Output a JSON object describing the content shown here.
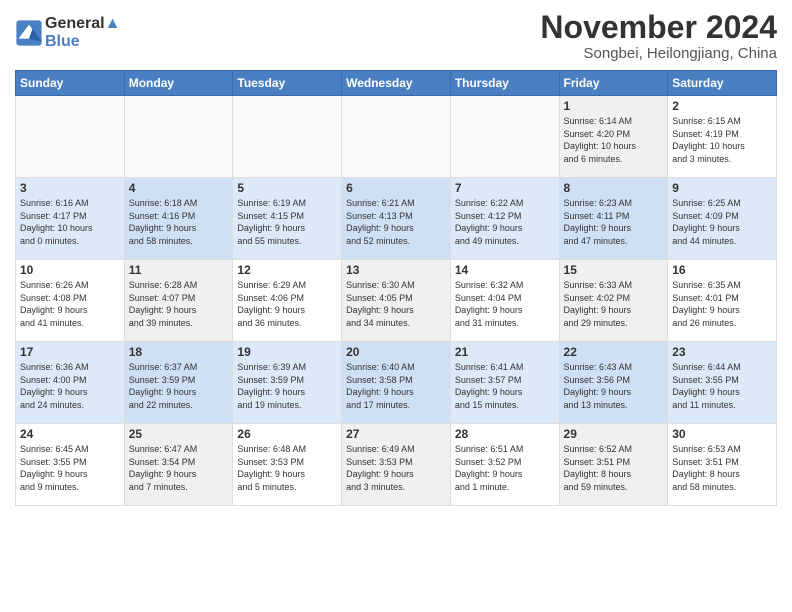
{
  "header": {
    "logo_line1": "General",
    "logo_line2": "Blue",
    "month": "November 2024",
    "location": "Songbei, Heilongjiang, China"
  },
  "days_of_week": [
    "Sunday",
    "Monday",
    "Tuesday",
    "Wednesday",
    "Thursday",
    "Friday",
    "Saturday"
  ],
  "weeks": [
    [
      {
        "day": "",
        "info": ""
      },
      {
        "day": "",
        "info": ""
      },
      {
        "day": "",
        "info": ""
      },
      {
        "day": "",
        "info": ""
      },
      {
        "day": "",
        "info": ""
      },
      {
        "day": "1",
        "info": "Sunrise: 6:14 AM\nSunset: 4:20 PM\nDaylight: 10 hours\nand 6 minutes."
      },
      {
        "day": "2",
        "info": "Sunrise: 6:15 AM\nSunset: 4:19 PM\nDaylight: 10 hours\nand 3 minutes."
      }
    ],
    [
      {
        "day": "3",
        "info": "Sunrise: 6:16 AM\nSunset: 4:17 PM\nDaylight: 10 hours\nand 0 minutes."
      },
      {
        "day": "4",
        "info": "Sunrise: 6:18 AM\nSunset: 4:16 PM\nDaylight: 9 hours\nand 58 minutes."
      },
      {
        "day": "5",
        "info": "Sunrise: 6:19 AM\nSunset: 4:15 PM\nDaylight: 9 hours\nand 55 minutes."
      },
      {
        "day": "6",
        "info": "Sunrise: 6:21 AM\nSunset: 4:13 PM\nDaylight: 9 hours\nand 52 minutes."
      },
      {
        "day": "7",
        "info": "Sunrise: 6:22 AM\nSunset: 4:12 PM\nDaylight: 9 hours\nand 49 minutes."
      },
      {
        "day": "8",
        "info": "Sunrise: 6:23 AM\nSunset: 4:11 PM\nDaylight: 9 hours\nand 47 minutes."
      },
      {
        "day": "9",
        "info": "Sunrise: 6:25 AM\nSunset: 4:09 PM\nDaylight: 9 hours\nand 44 minutes."
      }
    ],
    [
      {
        "day": "10",
        "info": "Sunrise: 6:26 AM\nSunset: 4:08 PM\nDaylight: 9 hours\nand 41 minutes."
      },
      {
        "day": "11",
        "info": "Sunrise: 6:28 AM\nSunset: 4:07 PM\nDaylight: 9 hours\nand 39 minutes."
      },
      {
        "day": "12",
        "info": "Sunrise: 6:29 AM\nSunset: 4:06 PM\nDaylight: 9 hours\nand 36 minutes."
      },
      {
        "day": "13",
        "info": "Sunrise: 6:30 AM\nSunset: 4:05 PM\nDaylight: 9 hours\nand 34 minutes."
      },
      {
        "day": "14",
        "info": "Sunrise: 6:32 AM\nSunset: 4:04 PM\nDaylight: 9 hours\nand 31 minutes."
      },
      {
        "day": "15",
        "info": "Sunrise: 6:33 AM\nSunset: 4:02 PM\nDaylight: 9 hours\nand 29 minutes."
      },
      {
        "day": "16",
        "info": "Sunrise: 6:35 AM\nSunset: 4:01 PM\nDaylight: 9 hours\nand 26 minutes."
      }
    ],
    [
      {
        "day": "17",
        "info": "Sunrise: 6:36 AM\nSunset: 4:00 PM\nDaylight: 9 hours\nand 24 minutes."
      },
      {
        "day": "18",
        "info": "Sunrise: 6:37 AM\nSunset: 3:59 PM\nDaylight: 9 hours\nand 22 minutes."
      },
      {
        "day": "19",
        "info": "Sunrise: 6:39 AM\nSunset: 3:59 PM\nDaylight: 9 hours\nand 19 minutes."
      },
      {
        "day": "20",
        "info": "Sunrise: 6:40 AM\nSunset: 3:58 PM\nDaylight: 9 hours\nand 17 minutes."
      },
      {
        "day": "21",
        "info": "Sunrise: 6:41 AM\nSunset: 3:57 PM\nDaylight: 9 hours\nand 15 minutes."
      },
      {
        "day": "22",
        "info": "Sunrise: 6:43 AM\nSunset: 3:56 PM\nDaylight: 9 hours\nand 13 minutes."
      },
      {
        "day": "23",
        "info": "Sunrise: 6:44 AM\nSunset: 3:55 PM\nDaylight: 9 hours\nand 11 minutes."
      }
    ],
    [
      {
        "day": "24",
        "info": "Sunrise: 6:45 AM\nSunset: 3:55 PM\nDaylight: 9 hours\nand 9 minutes."
      },
      {
        "day": "25",
        "info": "Sunrise: 6:47 AM\nSunset: 3:54 PM\nDaylight: 9 hours\nand 7 minutes."
      },
      {
        "day": "26",
        "info": "Sunrise: 6:48 AM\nSunset: 3:53 PM\nDaylight: 9 hours\nand 5 minutes."
      },
      {
        "day": "27",
        "info": "Sunrise: 6:49 AM\nSunset: 3:53 PM\nDaylight: 9 hours\nand 3 minutes."
      },
      {
        "day": "28",
        "info": "Sunrise: 6:51 AM\nSunset: 3:52 PM\nDaylight: 9 hours\nand 1 minute."
      },
      {
        "day": "29",
        "info": "Sunrise: 6:52 AM\nSunset: 3:51 PM\nDaylight: 8 hours\nand 59 minutes."
      },
      {
        "day": "30",
        "info": "Sunrise: 6:53 AM\nSunset: 3:51 PM\nDaylight: 8 hours\nand 58 minutes."
      }
    ]
  ]
}
